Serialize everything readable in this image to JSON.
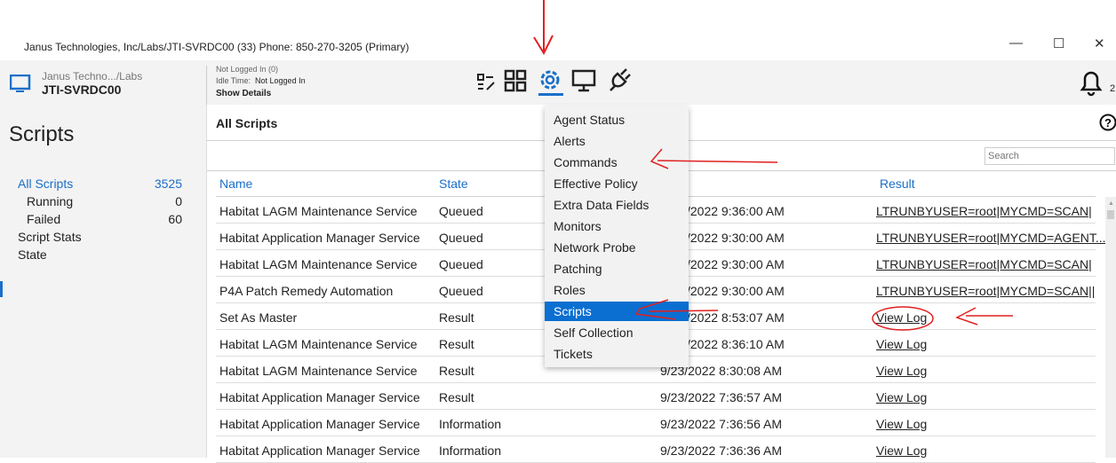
{
  "window": {
    "title": "Janus Technologies, Inc/Labs/JTI-SVRDC00 (33) Phone: 850-270-3205 (Primary)",
    "minimize": "—",
    "maximize": "☐",
    "close": "✕"
  },
  "header": {
    "org": "Janus Techno.../Labs",
    "host": "JTI-SVRDC00",
    "login_status": "Not Logged In (0)",
    "idle_label": "Idle Time:",
    "idle_value": "Not Logged In",
    "show_details": "Show Details",
    "notification_count": "2"
  },
  "sidebar": {
    "title": "Scripts",
    "items": [
      {
        "label": "All Scripts",
        "count": "3525"
      },
      {
        "label": "Running",
        "count": "0"
      },
      {
        "label": "Failed",
        "count": "60"
      },
      {
        "label": "Script Stats"
      },
      {
        "label": "State"
      }
    ]
  },
  "main": {
    "title": "All Scripts",
    "search_placeholder": "Search",
    "columns": [
      "Name",
      "State",
      "",
      "Result"
    ],
    "rows": [
      {
        "name": "Habitat LAGM Maintenance Service",
        "state": "Queued",
        "date": "/2022 9:36:00 AM",
        "result": "LTRUNBYUSER=root|MYCMD=SCAN|"
      },
      {
        "name": "Habitat Application Manager Service",
        "state": "Queued",
        "date": "/2022 9:30:00 AM",
        "result": "LTRUNBYUSER=root|MYCMD=AGENT..."
      },
      {
        "name": "Habitat LAGM Maintenance Service",
        "state": "Queued",
        "date": "/2022 9:30:00 AM",
        "result": "LTRUNBYUSER=root|MYCMD=SCAN|"
      },
      {
        "name": "P4A Patch Remedy Automation",
        "state": "Queued",
        "date": "/2022 9:30:00 AM",
        "result": "LTRUNBYUSER=root|MYCMD=SCAN||"
      },
      {
        "name": "Set As Master",
        "state": "Result",
        "date": "/2022 8:53:07 AM",
        "result": "View Log"
      },
      {
        "name": "Habitat LAGM Maintenance Service",
        "state": "Result",
        "date": "/2022 8:36:10 AM",
        "result": "View Log"
      },
      {
        "name": "Habitat LAGM Maintenance Service",
        "state": "Result",
        "date": "9/23/2022 8:30:08 AM",
        "result": "View Log"
      },
      {
        "name": "Habitat Application Manager Service",
        "state": "Result",
        "date": "9/23/2022 7:36:57 AM",
        "result": "View Log"
      },
      {
        "name": "Habitat Application Manager Service",
        "state": "Information",
        "date": "9/23/2022 7:36:56 AM",
        "result": "View Log"
      },
      {
        "name": "Habitat Application Manager Service",
        "state": "Information",
        "date": "9/23/2022 7:36:36 AM",
        "result": "View Log"
      }
    ]
  },
  "menu": {
    "items": [
      "Agent Status",
      "Alerts",
      "Commands",
      "Effective Policy",
      "Extra Data Fields",
      "Monitors",
      "Network Probe",
      "Patching",
      "Roles",
      "Scripts",
      "Self Collection",
      "Tickets"
    ],
    "selected": "Scripts"
  },
  "colors": {
    "accent": "#1a6fc9",
    "selected": "#0a6fd1",
    "annotation": "#e02020"
  }
}
